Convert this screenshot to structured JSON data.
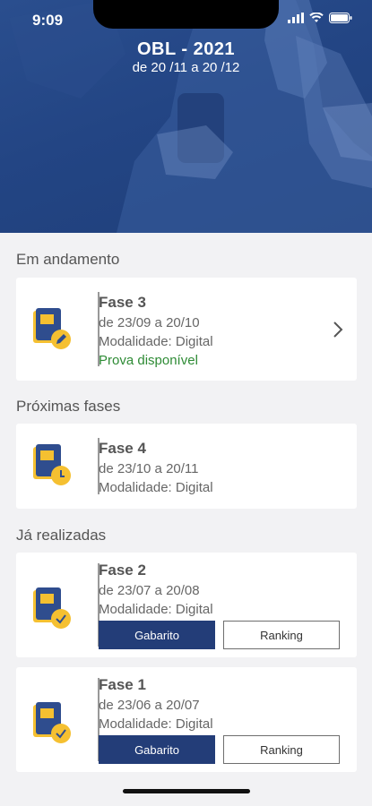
{
  "status_bar": {
    "time": "9:09"
  },
  "header": {
    "title": "OBL - 2021",
    "subtitle": "de 20 /11 a 20 /12"
  },
  "sections": {
    "in_progress": "Em andamento",
    "upcoming": "Próximas fases",
    "completed": "Já realizadas"
  },
  "phases": {
    "fase3": {
      "name": "Fase 3",
      "dates": "de 23/09 a 20/10",
      "mode": "Modalidade: Digital",
      "status": "Prova disponível"
    },
    "fase4": {
      "name": "Fase 4",
      "dates": "de 23/10 a 20/11",
      "mode": "Modalidade: Digital"
    },
    "fase2": {
      "name": "Fase 2",
      "dates": "de 23/07 a 20/08",
      "mode": "Modalidade: Digital",
      "gabarito": "Gabarito",
      "ranking": "Ranking"
    },
    "fase1": {
      "name": "Fase 1",
      "dates": "de 23/06 a 20/07",
      "mode": "Modalidade: Digital",
      "gabarito": "Gabarito",
      "ranking": "Ranking"
    }
  },
  "icons": {
    "book_edit": "book-edit-icon",
    "book_clock": "book-clock-icon",
    "book_check": "book-check-icon"
  },
  "colors": {
    "primary": "#233d78",
    "hero": "#244685",
    "available": "#2e8b35",
    "badge": "#f5c031",
    "book": "#2f4d8e"
  }
}
